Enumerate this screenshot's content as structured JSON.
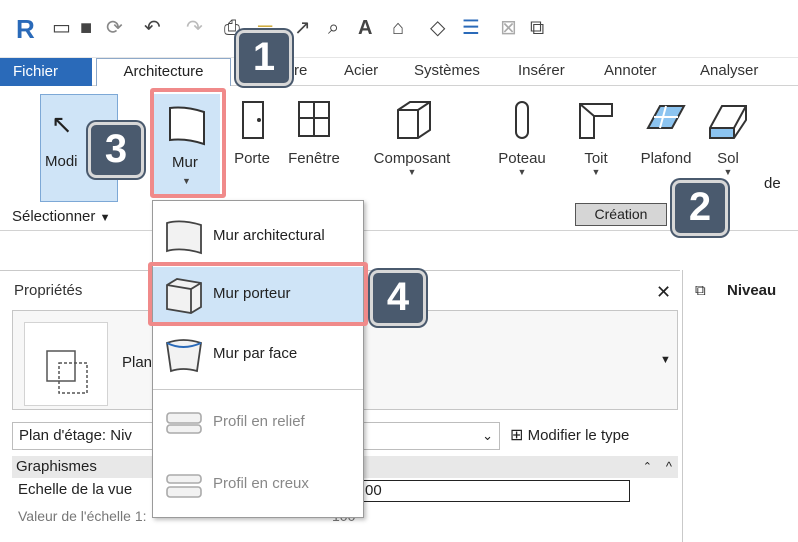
{
  "colors": {
    "accent": "#2a6ab9",
    "callout_bg": "#4a5a6e",
    "highlight": "#f08a8a",
    "selected_bg": "#cfe4f7"
  },
  "qat": {
    "icons": [
      "revit-logo-icon",
      "open-icon",
      "save-icon",
      "sync-icon",
      "undo-icon",
      "redo-icon",
      "print-icon",
      "measure-icon",
      "dimension-icon",
      "tag-icon",
      "text-icon",
      "3d-view-icon",
      "section-icon",
      "thin-lines-icon",
      "close-hidden-icon",
      "switch-windows-icon"
    ],
    "logo_letter": "R"
  },
  "menubar": {
    "file": "Fichier",
    "items": [
      "Architecture",
      "re",
      "Acier",
      "Systèmes",
      "Insérer",
      "Annoter",
      "Analyser"
    ]
  },
  "ribbon": {
    "modify_label": "Modi",
    "buttons": [
      "Mur",
      "Porte",
      "Fenêtre",
      "Composant",
      "Poteau",
      "Toit",
      "Plafond",
      "Sol",
      "de"
    ],
    "select_panel": "Sélectionner",
    "creation_panel": "Création"
  },
  "callouts": [
    "1",
    "2",
    "3",
    "4"
  ],
  "dropdown": {
    "items": [
      {
        "label": "Mur architectural",
        "enabled": true
      },
      {
        "label": "Mur porteur",
        "enabled": true,
        "highlighted": true
      },
      {
        "label": "Mur par face",
        "enabled": true
      },
      {
        "label": "Profil en relief",
        "enabled": false
      },
      {
        "label": "Profil en creux",
        "enabled": false
      }
    ]
  },
  "properties": {
    "title": "Propriétés",
    "close": "✕",
    "type_name": "Plan",
    "plan_selector": "Plan d'étage: Niv",
    "modify_type": "Modifier le type",
    "group": "Graphismes",
    "rows": [
      {
        "label": "Echelle de la vue",
        "value": "00"
      },
      {
        "label": "Valeur de l'échelle   1:",
        "value": "100"
      }
    ]
  },
  "right_panel": {
    "title": "Niveau"
  }
}
